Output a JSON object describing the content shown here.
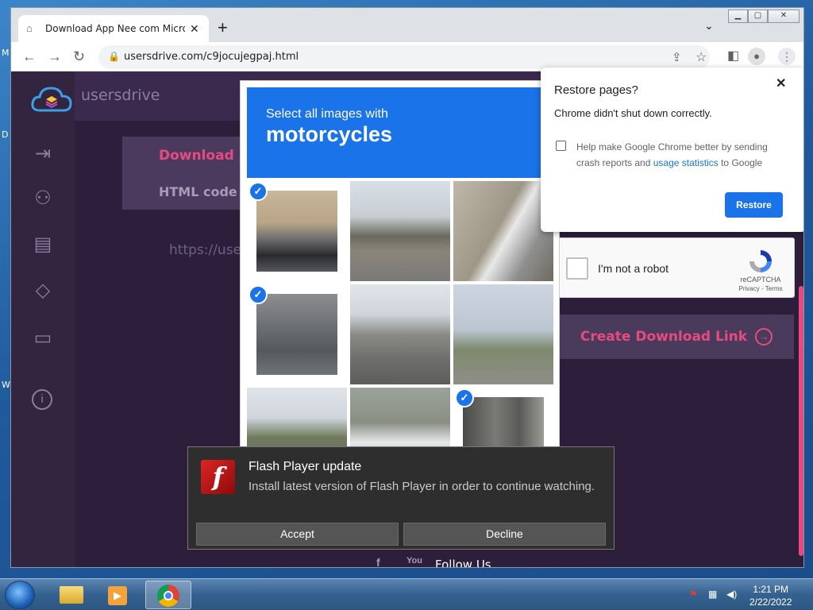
{
  "browser": {
    "tab_title": "Download App Nee com Microso",
    "url": "usersdrive.com/c9jocujegpaj.html"
  },
  "site": {
    "brand": "usersdrive",
    "download_link_label": "Download li",
    "html_code_label": "HTML code",
    "url_fragment": "https://use",
    "create_download_link": "Create Download Link",
    "follow_us": "Follow Us",
    "accent_color": "#e84a7f"
  },
  "recaptcha": {
    "label": "I'm not a robot",
    "brand": "reCAPTCHA",
    "terms": "Privacy - Terms"
  },
  "challenge": {
    "instruction": "Select all images with",
    "target": "motorcycles",
    "tiles_selected": [
      true,
      false,
      false,
      true,
      false,
      false,
      false,
      false,
      true
    ]
  },
  "restore_dialog": {
    "title": "Restore pages?",
    "message": "Chrome didn't shut down correctly.",
    "checkbox_text_1": "Help make Google Chrome better by sending crash reports and ",
    "checkbox_link": "usage statistics",
    "checkbox_text_2": " to Google",
    "button": "Restore"
  },
  "flash_popup": {
    "title": "Flash Player update",
    "message": "Install latest version of Flash Player in order to continue watching.",
    "accept": "Accept",
    "decline": "Decline",
    "logo_letter": "f"
  },
  "taskbar": {
    "time": "1:21 PM",
    "date": "2/22/2022"
  },
  "desktop_fragments": [
    "M",
    "D",
    "W"
  ]
}
